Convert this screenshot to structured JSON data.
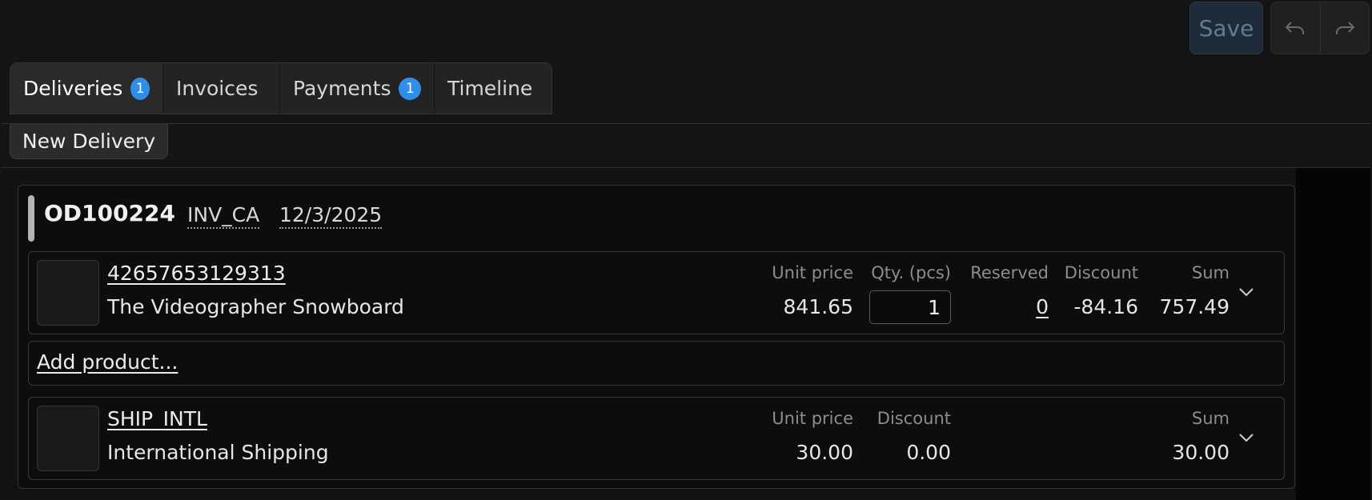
{
  "toolbar": {
    "save_label": "Save",
    "undo_icon": "undo-icon",
    "redo_icon": "redo-icon"
  },
  "tabs": [
    {
      "label": "Deliveries",
      "badge": "1",
      "active": true
    },
    {
      "label": "Invoices"
    },
    {
      "label": "Payments",
      "badge": "1"
    },
    {
      "label": "Timeline"
    }
  ],
  "panel": {
    "new_delivery_label": "New Delivery"
  },
  "order": {
    "id": "OD100224",
    "location": "INV_CA",
    "date": "12/3/2025",
    "accent_color": "#b3b3b3"
  },
  "line_items": [
    {
      "sku": "42657653129313",
      "name": "The Videographer Snowboard",
      "labels": {
        "unit_price": "Unit price",
        "qty": "Qty. (pcs)",
        "reserved": "Reserved",
        "discount": "Discount",
        "sum": "Sum"
      },
      "unit_price": "841.65",
      "qty": "1",
      "reserved": "0",
      "discount": "-84.16",
      "sum": "757.49"
    }
  ],
  "add_product_label": "Add product...",
  "shipping": {
    "code": "SHIP_INTL",
    "name": "International Shipping",
    "labels": {
      "unit_price": "Unit price",
      "discount": "Discount",
      "sum": "Sum"
    },
    "unit_price": "30.00",
    "discount": "0.00",
    "sum": "30.00"
  },
  "colors": {
    "badge": "#2f8fe8",
    "save_bg": "#1d2c38"
  }
}
